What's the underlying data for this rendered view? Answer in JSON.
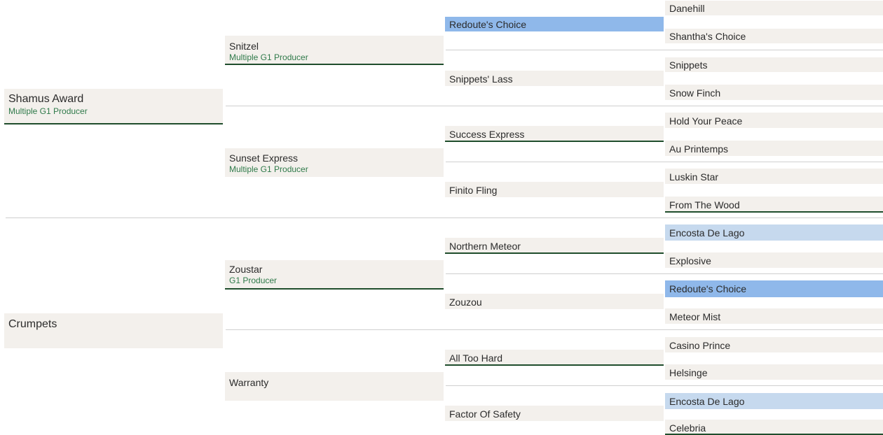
{
  "pedigree": {
    "sire": {
      "name": "Shamus Award",
      "sub": "Multiple G1 Producer"
    },
    "dam": {
      "name": "Crumpets"
    },
    "sire_sire": {
      "name": "Snitzel",
      "sub": "Multiple G1 Producer"
    },
    "sire_dam": {
      "name": "Sunset Express",
      "sub": "Multiple G1 Producer"
    },
    "dam_sire": {
      "name": "Zoustar",
      "sub": "G1 Producer"
    },
    "dam_dam": {
      "name": "Warranty"
    },
    "g3": [
      "Redoute's Choice",
      "Snippets' Lass",
      "Success Express",
      "Finito Fling",
      "Northern Meteor",
      "Zouzou",
      "All Too Hard",
      "Factor Of Safety"
    ],
    "g4": [
      "Danehill",
      "Shantha's Choice",
      "Snippets",
      "Snow Finch",
      "Hold Your Peace",
      "Au Printemps",
      "Luskin Star",
      "From The Wood",
      "Encosta De Lago",
      "Explosive",
      "Redoute's Choice",
      "Meteor Mist",
      "Casino Prince",
      "Helsinge",
      "Encosta De Lago",
      "Celebria"
    ],
    "colors": {
      "cell_bg": "#f3f0ec",
      "highlight_strong": "#8fb8ea",
      "highlight_light": "#c6d9ee",
      "underline": "#1f4d2c",
      "producer_text": "#2f7a4a"
    }
  }
}
